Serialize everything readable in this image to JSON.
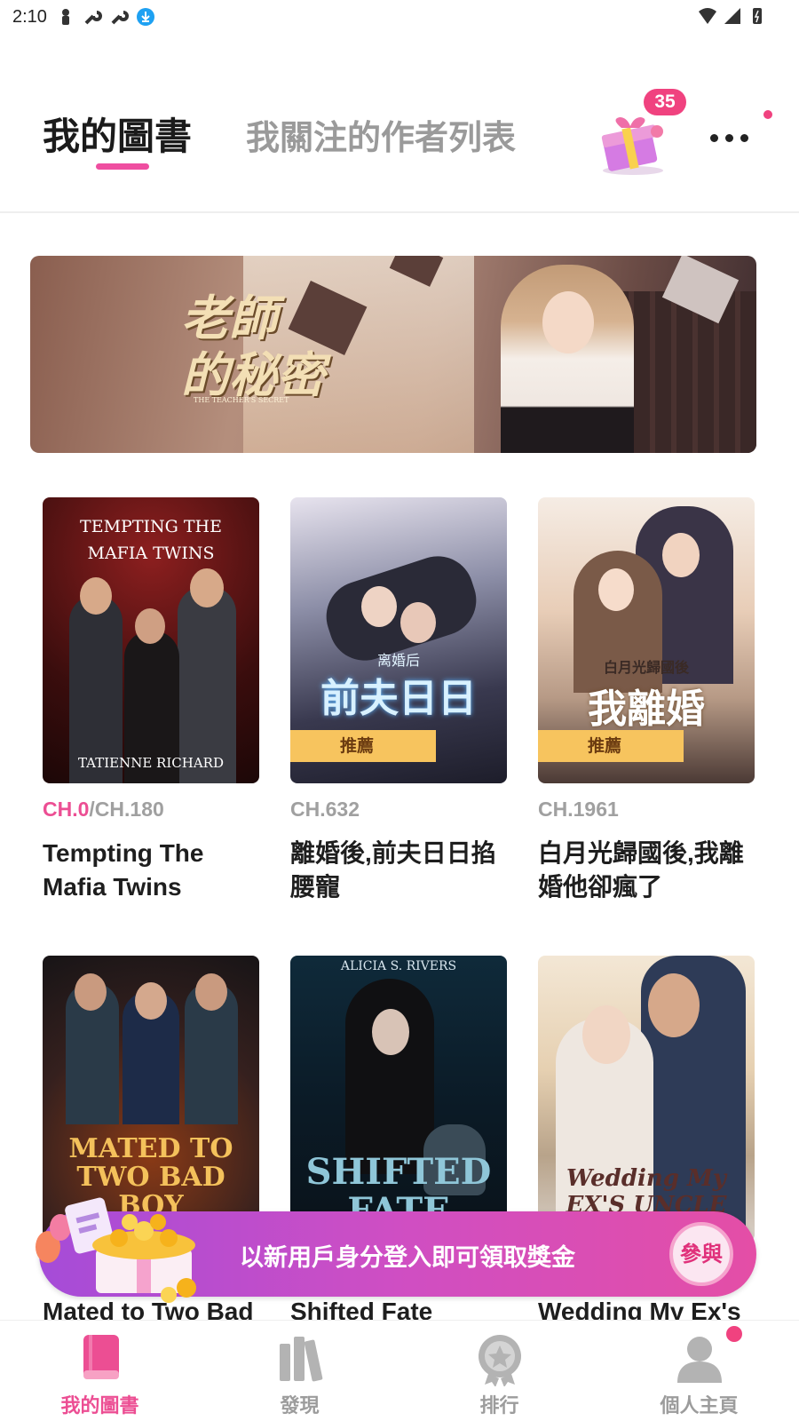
{
  "status_bar": {
    "time": "2:10"
  },
  "header": {
    "tabs": [
      {
        "label": "我的圖書",
        "active": true
      },
      {
        "label": "我關注的作者列表",
        "active": false
      }
    ],
    "gift_badge": "35",
    "accent_color": "#ef4ea0"
  },
  "banner": {
    "title_line1": "老師",
    "title_line2": "的秘密",
    "subtitle": "THE TEACHER'S SECRET"
  },
  "books": [
    {
      "title": "Tempting The Mafia Twins",
      "chapter_current": "CH.0",
      "chapter_total": "/CH.180",
      "cover_text": "TEMPTING THE MAFIA TWINS",
      "cover_author": "TATIENNE RICHARD",
      "ribbon": ""
    },
    {
      "title": "離婚後,前夫日日掐腰寵",
      "chapter_current": "",
      "chapter_total": "CH.632",
      "cover_text": "前夫日日",
      "cover_author": "离婚后",
      "ribbon": "推薦"
    },
    {
      "title": "白月光歸國後,我離婚他卻瘋了",
      "chapter_current": "",
      "chapter_total": "CH.1961",
      "cover_text": "我離婚",
      "cover_author": "白月光歸國後",
      "ribbon": "推薦"
    },
    {
      "title": "Mated to Two Bad",
      "chapter_current": "",
      "chapter_total": "",
      "cover_text": "MATED TO TWO BAD BOY ALPHAS",
      "cover_author": "",
      "ribbon": ""
    },
    {
      "title": "Shifted Fate",
      "chapter_current": "",
      "chapter_total": "",
      "cover_text": "SHIFTED FATE",
      "cover_author": "ALICIA S. RIVERS",
      "ribbon": ""
    },
    {
      "title": "Wedding My Ex's",
      "chapter_current": "",
      "chapter_total": "",
      "cover_text": "Wedding My EX'S UNCLE",
      "cover_author": "",
      "ribbon": ""
    }
  ],
  "promo": {
    "text": "以新用戶身分登入即可領取獎金",
    "button": "參與"
  },
  "bottom_nav": [
    {
      "label": "我的圖書",
      "icon": "book-icon",
      "active": true
    },
    {
      "label": "發現",
      "icon": "library-icon",
      "active": false
    },
    {
      "label": "排行",
      "icon": "ranking-icon",
      "active": false
    },
    {
      "label": "個人主頁",
      "icon": "profile-icon",
      "active": false
    }
  ]
}
